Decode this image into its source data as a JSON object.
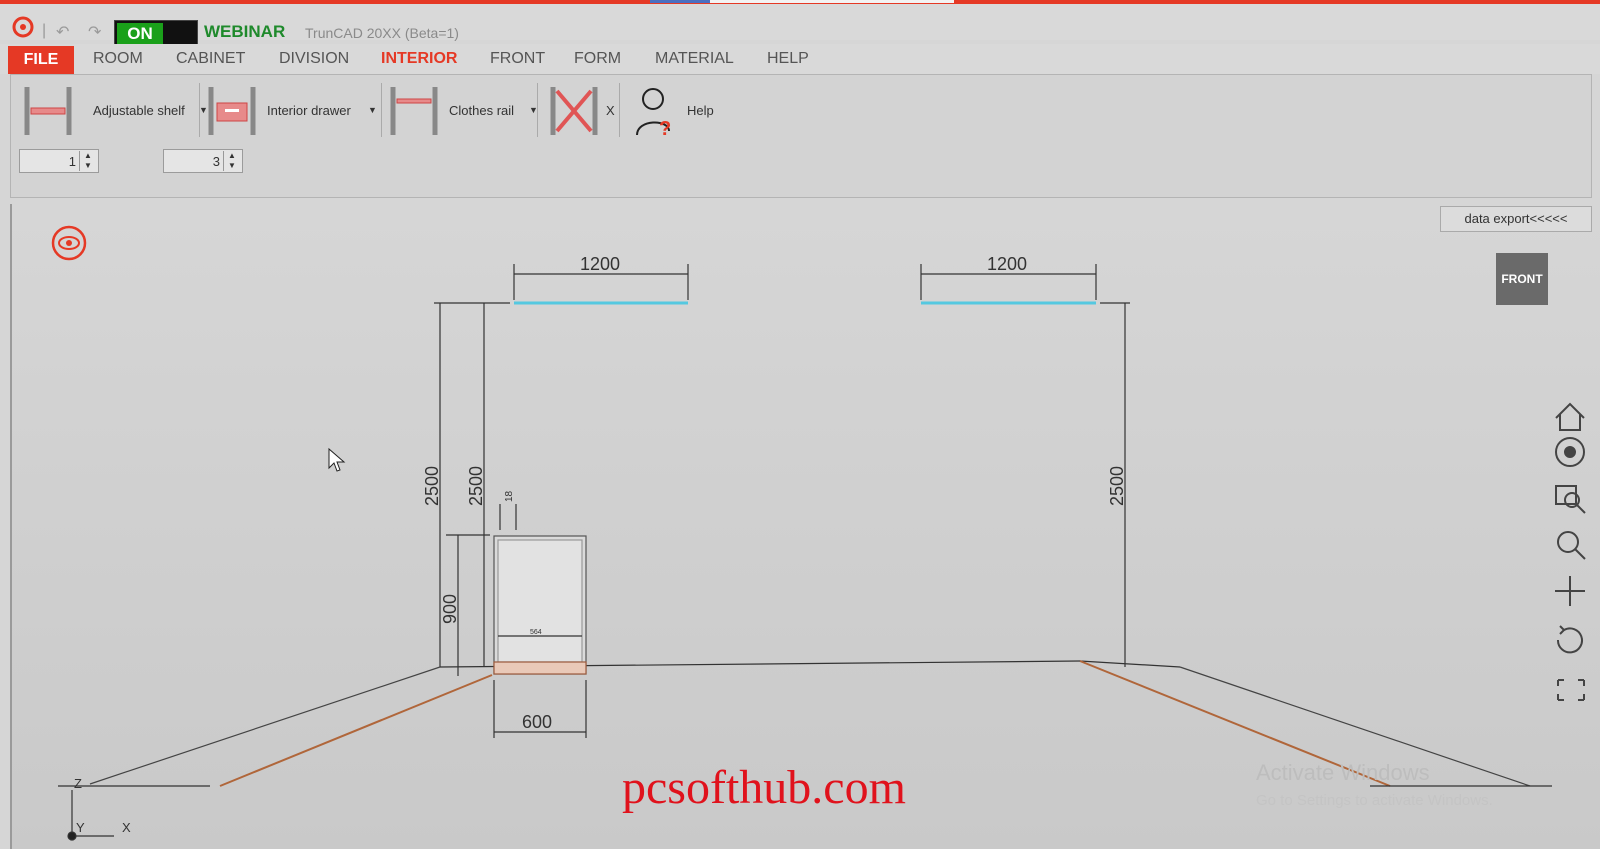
{
  "app": {
    "title": "TrunCAD 20XX (Beta=1)",
    "toggle_label": "ON",
    "badge": "WEBINAR"
  },
  "menu": {
    "file": "FILE",
    "items": [
      "ROOM",
      "CABINET",
      "DIVISION",
      "INTERIOR",
      "FRONT",
      "FORM",
      "MATERIAL",
      "HELP"
    ],
    "active": "INTERIOR"
  },
  "ribbon": {
    "adjustable_shelf": "Adjustable shelf",
    "interior_drawer": "Interior drawer",
    "clothes_rail": "Clothes rail",
    "delete_label": "X",
    "help": "Help",
    "spin1": "1",
    "spin2": "3"
  },
  "viewport": {
    "data_export": "data export<<<<<",
    "nav_cube": "FRONT",
    "dims": {
      "wall_width_left": "1200",
      "wall_width_right": "1200",
      "height_left_outer": "2500",
      "height_left_inner": "2500",
      "height_right": "2500",
      "cabinet_height": "900",
      "cabinet_width": "600",
      "small_top": "18",
      "inner_width": "564"
    },
    "axes": {
      "z": "Z",
      "y": "Y",
      "x": "X"
    }
  },
  "watermark": "pcsofthub.com",
  "activation": {
    "line1": "Activate Windows",
    "line2": "Go to Settings to activate Windows."
  },
  "colors": {
    "accent": "#e53925",
    "on": "#1aa01a",
    "webinar": "#1f8a2c",
    "rail": "#55c8e0",
    "floor": "#b0663a"
  }
}
